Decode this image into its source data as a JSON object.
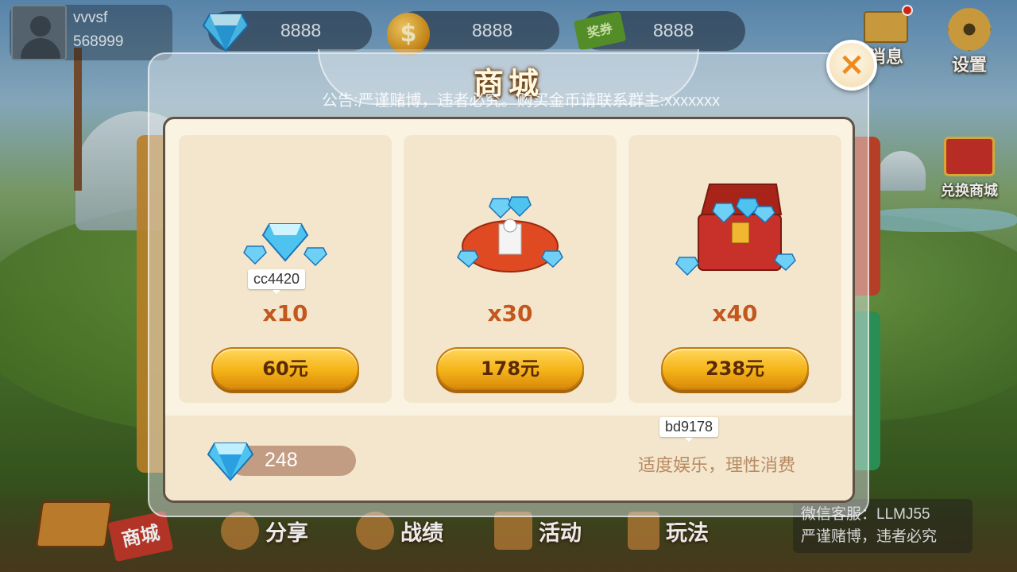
{
  "user": {
    "name": "vvvsf",
    "id": "568999"
  },
  "resources": {
    "diamonds": "8888",
    "gold": "8888",
    "tickets": "8888"
  },
  "icons": {
    "coin_symbol": "$",
    "ticket_label": "奖券",
    "close_symbol": "×"
  },
  "top_buttons": {
    "messages_label": "消息",
    "settings_label": "设置",
    "exchange_label": "兑换商城"
  },
  "modal": {
    "title": "商城",
    "announcement": "公告:严谨赌博，违者必究。购买金币请联系群主:xxxxxxx",
    "products": [
      {
        "tag": "cc4420",
        "quantity": "x10",
        "price": "60元",
        "art": "small-diamond-pile-icon"
      },
      {
        "tag": "",
        "quantity": "x30",
        "price": "178元",
        "art": "diamond-bag-icon"
      },
      {
        "tag": "",
        "quantity": "x40",
        "price": "238元",
        "art": "diamond-chest-icon"
      }
    ],
    "balance": "248",
    "footer_tag": "bd9178",
    "slogan": "适度娱乐，理性消费"
  },
  "bottom_nav": {
    "shop": "商城",
    "share": "分享",
    "records": "战绩",
    "activity": "活动",
    "rules": "玩法"
  },
  "notice": {
    "line1": "微信客服：LLMJ55",
    "line2": "严谨赌博，违者必究"
  },
  "colors": {
    "price_button": "#f4b318",
    "quantity_text": "#c2581e",
    "close_x": "#f08a1a",
    "panel_bg": "#fbf3e2"
  }
}
